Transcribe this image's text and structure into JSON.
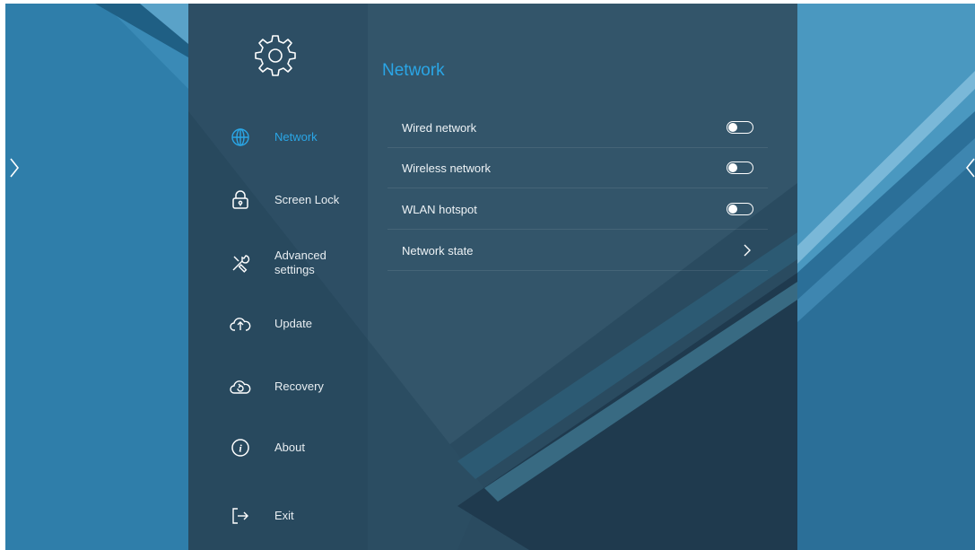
{
  "sidebar": {
    "items": [
      {
        "label": "Network",
        "icon": "globe-icon",
        "active": true
      },
      {
        "label": "Screen Lock",
        "icon": "lock-icon",
        "active": false
      },
      {
        "label": "Advanced\nsettings",
        "icon": "tools-icon",
        "active": false
      },
      {
        "label": "Update",
        "icon": "cloud-upload-icon",
        "active": false
      },
      {
        "label": "Recovery",
        "icon": "cloud-recovery-icon",
        "active": false
      },
      {
        "label": "About",
        "icon": "info-icon",
        "active": false
      },
      {
        "label": "Exit",
        "icon": "exit-icon",
        "active": false
      }
    ]
  },
  "content": {
    "title": "Network",
    "rows": [
      {
        "label": "Wired network",
        "control": "toggle",
        "on": false
      },
      {
        "label": "Wireless network",
        "control": "toggle",
        "on": false
      },
      {
        "label": "WLAN hotspot",
        "control": "toggle",
        "on": false
      },
      {
        "label": "Network state",
        "control": "chevron"
      }
    ]
  },
  "colors": {
    "accent": "#2aa6e6",
    "panel": "#2c4a5e",
    "backdrop": "#2e7ca8"
  }
}
